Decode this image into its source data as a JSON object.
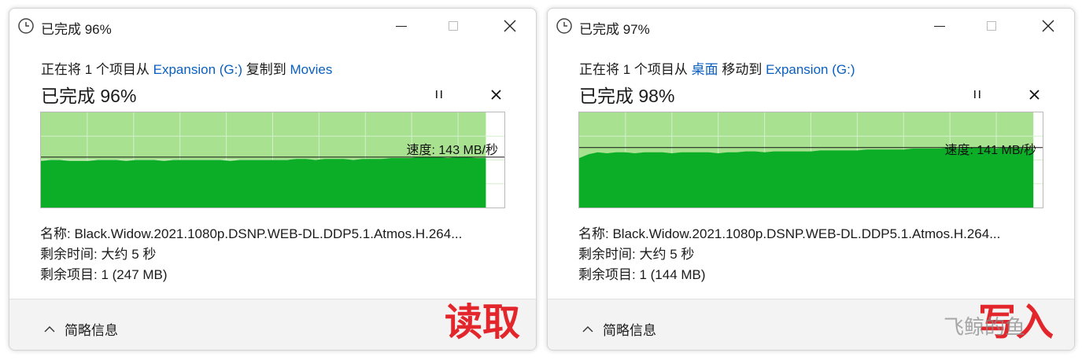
{
  "colors": {
    "graph_fill": "#0cae28",
    "graph_fill_light": "#a8e291",
    "graph_grid": "#d4efcc",
    "link": "#0a5fbf",
    "caption": "#e3262b"
  },
  "dialogs": [
    {
      "title": "已完成 96%",
      "sub_prefix": "正在将 1 个项目从",
      "source": "Expansion (G:)",
      "action": "复制到",
      "destination": "Movies",
      "progress_title": "已完成 96%",
      "progress_percent": 96,
      "speed_label": "速度: 143 MB/秒",
      "speed_fraction": 0.53,
      "series": [
        0.49,
        0.5,
        0.5,
        0.49,
        0.49,
        0.49,
        0.5,
        0.5,
        0.5,
        0.49,
        0.5,
        0.5,
        0.5,
        0.49,
        0.5,
        0.5,
        0.5,
        0.5,
        0.5,
        0.5,
        0.49,
        0.5,
        0.5,
        0.5,
        0.5,
        0.5,
        0.5,
        0.51,
        0.51,
        0.5,
        0.51,
        0.51,
        0.51,
        0.5,
        0.51,
        0.51,
        0.51,
        0.52,
        0.52,
        0.52,
        0.53,
        0.53,
        0.53,
        0.52,
        0.53,
        0.53,
        0.52,
        0.52
      ],
      "name_label": "名称:",
      "name_value": "Black.Widow.2021.1080p.DSNP.WEB-DL.DDP5.1.Atmos.H.264...",
      "time_label": "剩余时间:",
      "time_value": "大约 5 秒",
      "items_label": "剩余项目:",
      "items_value": "1 (247 MB)",
      "details_label": "简略信息",
      "caption": "读取"
    },
    {
      "title": "已完成 97%",
      "sub_prefix": "正在将 1 个项目从",
      "source": "桌面",
      "action": "移动到",
      "destination": "Expansion (G:)",
      "progress_title": "已完成 98%",
      "progress_percent": 98,
      "speed_label": "速度: 141 MB/秒",
      "speed_fraction": 0.63,
      "series": [
        0.52,
        0.56,
        0.58,
        0.57,
        0.58,
        0.58,
        0.57,
        0.58,
        0.58,
        0.58,
        0.57,
        0.58,
        0.58,
        0.58,
        0.58,
        0.57,
        0.58,
        0.58,
        0.59,
        0.59,
        0.58,
        0.59,
        0.59,
        0.59,
        0.59,
        0.59,
        0.6,
        0.6,
        0.6,
        0.6,
        0.6,
        0.61,
        0.61,
        0.61,
        0.61,
        0.61,
        0.62,
        0.62,
        0.62,
        0.62,
        0.63,
        0.62,
        0.63,
        0.63,
        0.63,
        0.62,
        0.63,
        0.63,
        0.62,
        0.62
      ],
      "name_label": "名称:",
      "name_value": "Black.Widow.2021.1080p.DSNP.WEB-DL.DDP5.1.Atmos.H.264...",
      "time_label": "剩余时间:",
      "time_value": "大约 5 秒",
      "items_label": "剩余项目:",
      "items_value": "1 (144 MB)",
      "details_label": "简略信息",
      "caption": "写入"
    }
  ],
  "watermark": "飞鲸的鱼"
}
